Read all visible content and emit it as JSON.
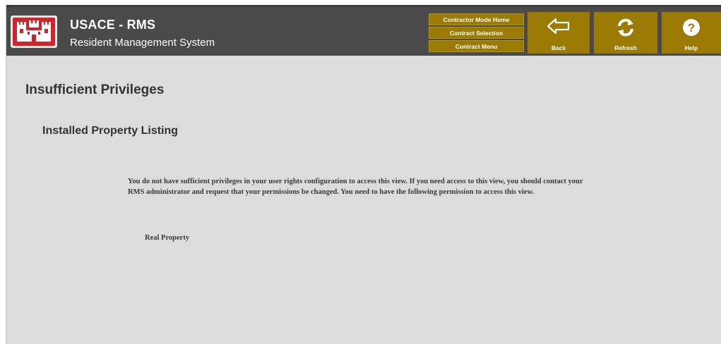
{
  "app": {
    "title": "USACE - RMS",
    "subtitle": "Resident Management System"
  },
  "nav": {
    "links": [
      "Contractor Mode Home",
      "Contract Selection",
      "Contract Menu"
    ],
    "back_label": "Back",
    "refresh_label": "Refresh",
    "help_label": "Help"
  },
  "page": {
    "title": "Insufficient Privileges",
    "section": "Installed Property Listing",
    "message": "You do not have sufficient privileges in your user rights configuration to access this view. If you need access to this view, you should contact your RMS administrator and request that your permissions be changed. You need to have the following permission to access this view.",
    "permission": "Real Property"
  },
  "icons": {
    "logo": "castle-logo",
    "back": "back-arrow-icon",
    "refresh": "refresh-icon",
    "help": "help-icon"
  },
  "colors": {
    "header_bg": "#4a4a4a",
    "accent_gold": "#9b7b05",
    "logo_red": "#d2232a",
    "content_bg": "#dcdcdc"
  }
}
